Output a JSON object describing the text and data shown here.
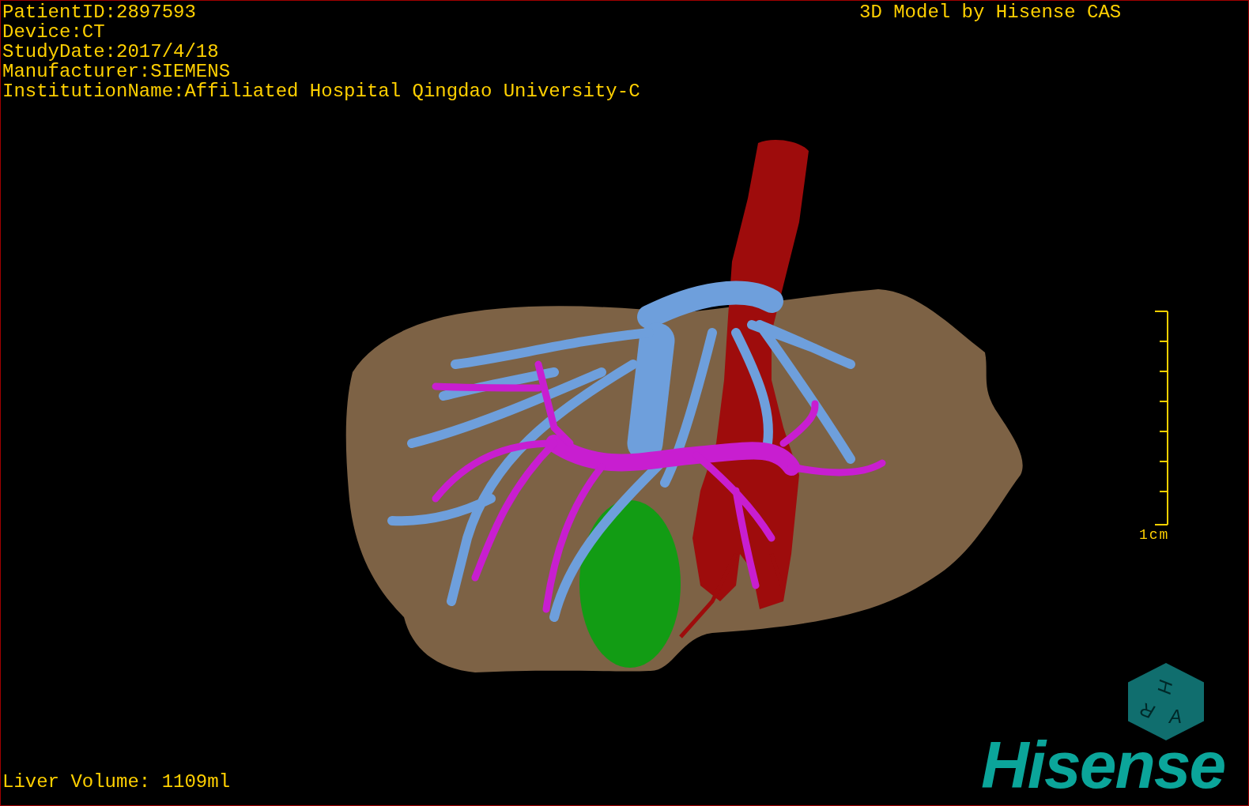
{
  "patient_info": [
    "PatientID:2897593",
    "Device:CT",
    "StudyDate:2017/4/18",
    "Manufacturer:SIEMENS",
    "InstitutionName:Affiliated Hospital Qingdao University-C"
  ],
  "title": "3D Model by Hisense CAS",
  "scale_bar": {
    "label": "1cm"
  },
  "orientation_cube": {
    "labels": [
      "H",
      "R",
      "A"
    ]
  },
  "logo": {
    "text": "Hisense"
  },
  "footer": "Liver Volume: 1109ml"
}
